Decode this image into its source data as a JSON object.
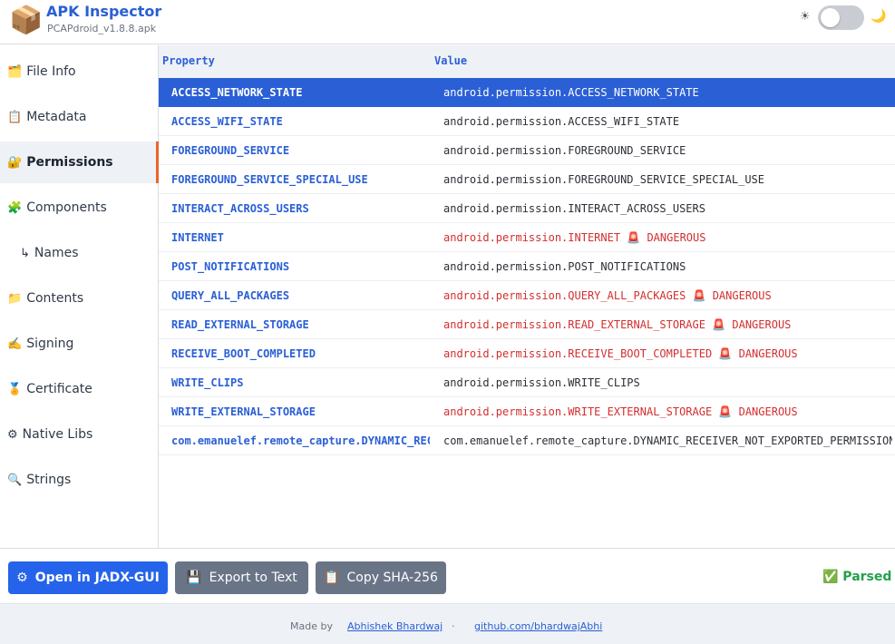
{
  "header": {
    "app_icon": "📦",
    "title": "APK Inspector",
    "subtitle": "PCAPdroid_v1.8.8.apk",
    "sun_icon": "☀",
    "moon_icon": "🌙"
  },
  "sidebar": {
    "items": [
      {
        "icon": "🗂️",
        "label": "File Info"
      },
      {
        "icon": "📋",
        "label": "Metadata"
      },
      {
        "icon": "🔐",
        "label": "Permissions"
      },
      {
        "icon": "🧩",
        "label": "Components"
      },
      {
        "icon": "↳",
        "label": "Names"
      },
      {
        "icon": "📁",
        "label": "Contents"
      },
      {
        "icon": "✍️",
        "label": "Signing"
      },
      {
        "icon": "🏅",
        "label": "Certificate"
      },
      {
        "icon": "⚙",
        "label": "Native Libs"
      },
      {
        "icon": "🔍",
        "label": "Strings"
      }
    ],
    "active_index": 2
  },
  "table": {
    "headers": {
      "property": "Property",
      "value": "Value"
    },
    "rows": [
      {
        "property": "ACCESS_NETWORK_STATE",
        "value": "android.permission.ACCESS_NETWORK_STATE",
        "dangerous": false
      },
      {
        "property": "ACCESS_WIFI_STATE",
        "value": "android.permission.ACCESS_WIFI_STATE",
        "dangerous": false
      },
      {
        "property": "FOREGROUND_SERVICE",
        "value": "android.permission.FOREGROUND_SERVICE",
        "dangerous": false
      },
      {
        "property": "FOREGROUND_SERVICE_SPECIAL_USE",
        "value": "android.permission.FOREGROUND_SERVICE_SPECIAL_USE",
        "dangerous": false
      },
      {
        "property": "INTERACT_ACROSS_USERS",
        "value": "android.permission.INTERACT_ACROSS_USERS",
        "dangerous": false
      },
      {
        "property": "INTERNET",
        "value": "android.permission.INTERNET 🚨 DANGEROUS",
        "dangerous": true
      },
      {
        "property": "POST_NOTIFICATIONS",
        "value": "android.permission.POST_NOTIFICATIONS",
        "dangerous": false
      },
      {
        "property": "QUERY_ALL_PACKAGES",
        "value": "android.permission.QUERY_ALL_PACKAGES 🚨 DANGEROUS",
        "dangerous": true
      },
      {
        "property": "READ_EXTERNAL_STORAGE",
        "value": "android.permission.READ_EXTERNAL_STORAGE 🚨 DANGEROUS",
        "dangerous": true
      },
      {
        "property": "RECEIVE_BOOT_COMPLETED",
        "value": "android.permission.RECEIVE_BOOT_COMPLETED 🚨 DANGEROUS",
        "dangerous": true
      },
      {
        "property": "WRITE_CLIPS",
        "value": "android.permission.WRITE_CLIPS",
        "dangerous": false
      },
      {
        "property": "WRITE_EXTERNAL_STORAGE",
        "value": "android.permission.WRITE_EXTERNAL_STORAGE 🚨 DANGEROUS",
        "dangerous": true
      },
      {
        "property": "com.emanuelef.remote_capture.DYNAMIC_RECEIVER_NOT_EXPORTED_PERMISSION",
        "value": "com.emanuelef.remote_capture.DYNAMIC_RECEIVER_NOT_EXPORTED_PERMISSION",
        "dangerous": false
      }
    ],
    "selected_index": 0
  },
  "actions": {
    "open_icon": "⚙",
    "open_label": "Open in JADX-GUI",
    "export_icon": "💾",
    "export_label": "Export to Text",
    "copy_icon": "📋",
    "copy_label": "Copy SHA-256",
    "status": "✅ Parsed"
  },
  "footer": {
    "made_by": "Made by",
    "author": "Abhishek Bhardwaj",
    "separator": "·",
    "repo": "github.com/bhardwajAbhi"
  },
  "colors": {
    "accent": "#2a5fd6",
    "danger": "#d32f2f",
    "success": "#22a04b",
    "active_marker": "#e8662b"
  }
}
